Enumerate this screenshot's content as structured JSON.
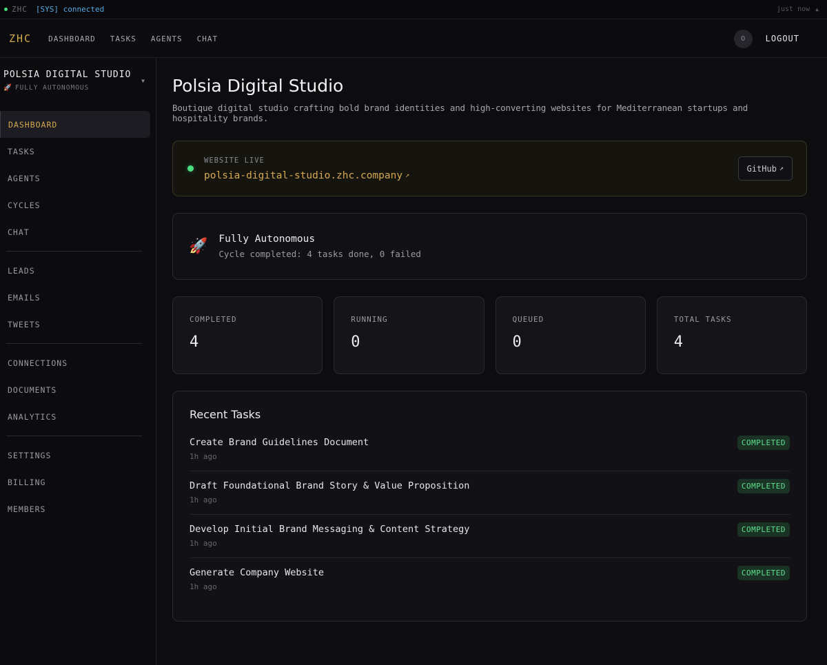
{
  "statusbar": {
    "brand": "ZHC",
    "message": "[SYS] connected",
    "time": "just now"
  },
  "topnav": {
    "logo": "ZHC",
    "links": [
      "DASHBOARD",
      "TASKS",
      "AGENTS",
      "CHAT"
    ],
    "avatar": "O",
    "logout": "LOGOUT"
  },
  "sidebar": {
    "org_name": "POLSIA DIGITAL STUDIO",
    "org_mode": "FULLY AUTONOMOUS",
    "groups": [
      [
        "DASHBOARD",
        "TASKS",
        "AGENTS",
        "CYCLES",
        "CHAT"
      ],
      [
        "LEADS",
        "EMAILS",
        "TWEETS"
      ],
      [
        "CONNECTIONS",
        "DOCUMENTS",
        "ANALYTICS"
      ],
      [
        "SETTINGS",
        "BILLING",
        "MEMBERS"
      ]
    ],
    "active": "DASHBOARD"
  },
  "main": {
    "title": "Polsia Digital Studio",
    "description": "Boutique digital studio crafting bold brand identities and high-converting websites for Mediterranean startups and hospitality brands.",
    "website": {
      "label": "WEBSITE LIVE",
      "url": "polsia-digital-studio.zhc.company",
      "github_label": "GitHub"
    },
    "autonomy": {
      "title": "Fully Autonomous",
      "subtitle": "Cycle completed: 4 tasks done, 0 failed"
    },
    "stats": [
      {
        "label": "COMPLETED",
        "value": "4"
      },
      {
        "label": "RUNNING",
        "value": "0"
      },
      {
        "label": "QUEUED",
        "value": "0"
      },
      {
        "label": "TOTAL TASKS",
        "value": "4"
      }
    ],
    "recent_tasks": {
      "title": "Recent Tasks",
      "items": [
        {
          "name": "Create Brand Guidelines Document",
          "time": "1h ago",
          "status": "COMPLETED"
        },
        {
          "name": "Draft Foundational Brand Story & Value Proposition",
          "time": "1h ago",
          "status": "COMPLETED"
        },
        {
          "name": "Develop Initial Brand Messaging & Content Strategy",
          "time": "1h ago",
          "status": "COMPLETED"
        },
        {
          "name": "Generate Company Website",
          "time": "1h ago",
          "status": "COMPLETED"
        }
      ]
    }
  },
  "colors": {
    "accent": "#d4a94f",
    "live": "#4ade80",
    "badge_bg": "#1b3325",
    "badge_text": "#5ee08e"
  },
  "icons": {
    "status": "status-dot-icon",
    "org_mode": "rocket-icon",
    "external_link": "external-link-icon",
    "autonomy": "rocket-icon"
  }
}
